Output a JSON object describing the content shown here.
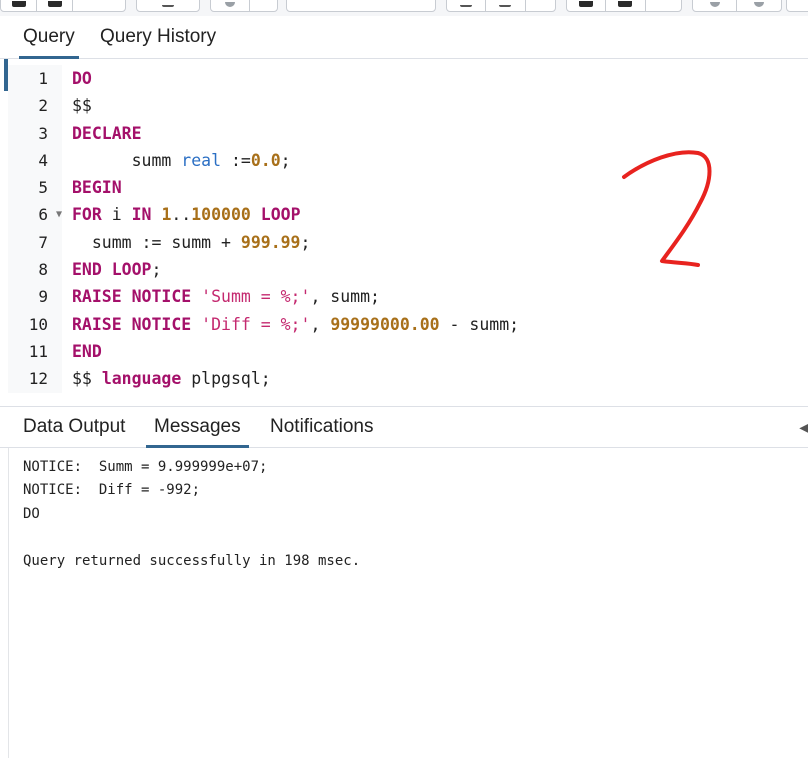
{
  "query_tabs": {
    "query": "Query",
    "history": "Query History"
  },
  "editor": {
    "line_numbers": [
      "1",
      "2",
      "3",
      "4",
      "5",
      "6",
      "7",
      "8",
      "9",
      "10",
      "11",
      "12"
    ],
    "fold_marker_line": "6",
    "lines": [
      [
        {
          "t": "DO",
          "c": "kw"
        }
      ],
      [
        {
          "t": "$$",
          "c": "pl"
        }
      ],
      [
        {
          "t": "DECLARE",
          "c": "kw"
        }
      ],
      [
        {
          "t": "      summ ",
          "c": "pl"
        },
        {
          "t": "real",
          "c": "ty"
        },
        {
          "t": " :=",
          "c": "pl"
        },
        {
          "t": "0.0",
          "c": "nm"
        },
        {
          "t": ";",
          "c": "pl"
        }
      ],
      [
        {
          "t": "BEGIN",
          "c": "kw"
        }
      ],
      [
        {
          "t": "FOR",
          "c": "kw"
        },
        {
          "t": " i ",
          "c": "pl"
        },
        {
          "t": "IN",
          "c": "kw"
        },
        {
          "t": " ",
          "c": "pl"
        },
        {
          "t": "1",
          "c": "nm"
        },
        {
          "t": "..",
          "c": "pl"
        },
        {
          "t": "100000",
          "c": "nm"
        },
        {
          "t": " ",
          "c": "pl"
        },
        {
          "t": "LOOP",
          "c": "kw"
        }
      ],
      [
        {
          "t": "  summ := summ + ",
          "c": "pl"
        },
        {
          "t": "999.99",
          "c": "nm"
        },
        {
          "t": ";",
          "c": "pl"
        }
      ],
      [
        {
          "t": "END",
          "c": "kw"
        },
        {
          "t": " ",
          "c": "pl"
        },
        {
          "t": "LOOP",
          "c": "kw"
        },
        {
          "t": ";",
          "c": "pl"
        }
      ],
      [
        {
          "t": "RAISE",
          "c": "kw"
        },
        {
          "t": " ",
          "c": "pl"
        },
        {
          "t": "NOTICE",
          "c": "kw"
        },
        {
          "t": " ",
          "c": "pl"
        },
        {
          "t": "'Summ = %;'",
          "c": "st"
        },
        {
          "t": ", summ;",
          "c": "pl"
        }
      ],
      [
        {
          "t": "RAISE",
          "c": "kw"
        },
        {
          "t": " ",
          "c": "pl"
        },
        {
          "t": "NOTICE",
          "c": "kw"
        },
        {
          "t": " ",
          "c": "pl"
        },
        {
          "t": "'Diff = %;'",
          "c": "st"
        },
        {
          "t": ", ",
          "c": "pl"
        },
        {
          "t": "99999000.00",
          "c": "nm"
        },
        {
          "t": " - summ;",
          "c": "pl"
        }
      ],
      [
        {
          "t": "END",
          "c": "kw"
        }
      ],
      [
        {
          "t": "$$ ",
          "c": "pl"
        },
        {
          "t": "language",
          "c": "kw"
        },
        {
          "t": " plpgsql;",
          "c": "pl"
        }
      ]
    ]
  },
  "result_tabs": {
    "data_output": "Data Output",
    "messages": "Messages",
    "notifications": "Notifications"
  },
  "messages": {
    "line1": "NOTICE:  Summ = 9.999999e+07;",
    "line2": "NOTICE:  Diff = -992;",
    "line3": "DO",
    "line4": "Query returned successfully in 198 msec."
  },
  "colors": {
    "accent": "#326690",
    "keyword": "#a4106a",
    "number": "#a8701a",
    "string": "#c4296f",
    "type": "#2b6fc4",
    "annotation": "#e8231f"
  }
}
